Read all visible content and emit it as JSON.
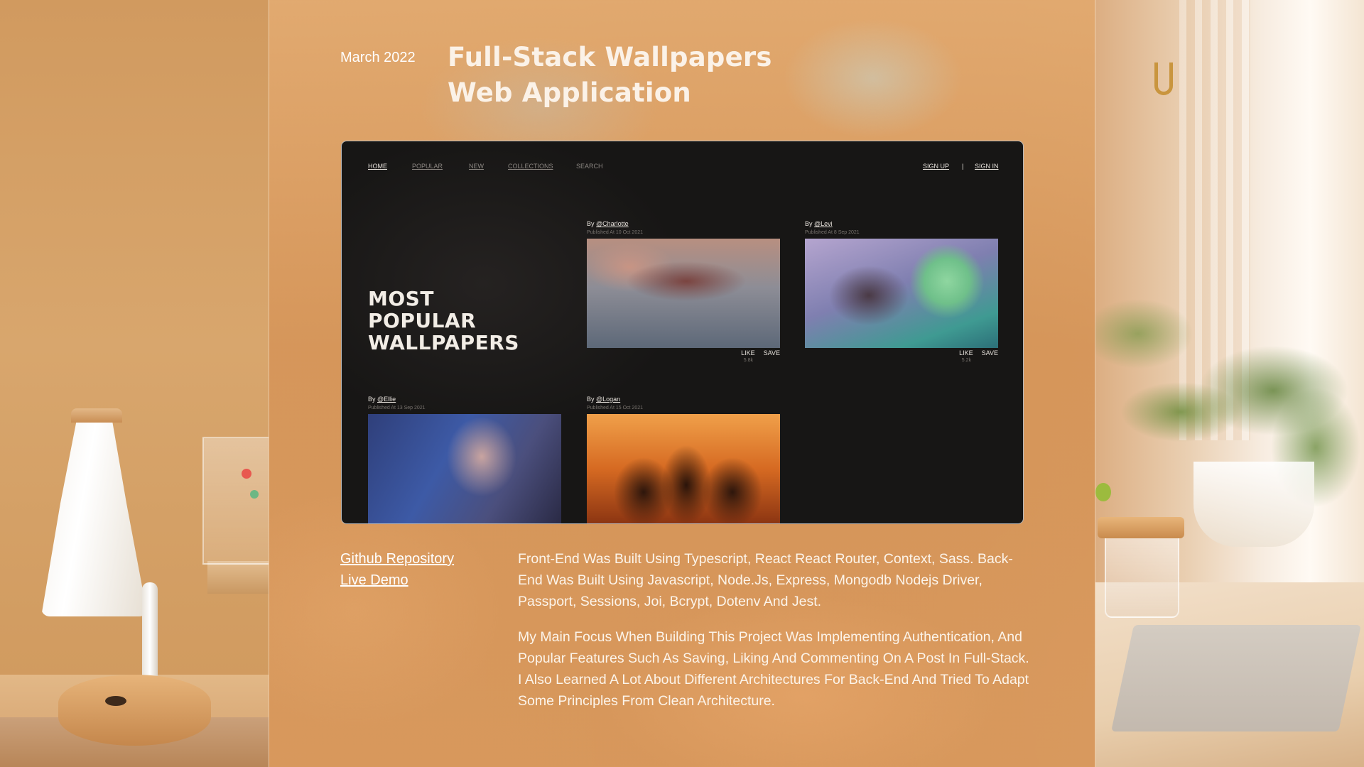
{
  "project": {
    "date": "March 2022",
    "title_line1": "Full-Stack Wallpapers",
    "title_line2": "Web Application"
  },
  "app": {
    "nav": [
      "HOME",
      "POPULAR",
      "NEW",
      "COLLECTIONS",
      "SEARCH"
    ],
    "auth": {
      "sign_up": "SIGN UP",
      "divider": "|",
      "sign_in": "SIGN IN"
    },
    "hero": [
      "MOST",
      "POPULAR",
      "WALLPAPERS"
    ],
    "cards": [
      {
        "by": "By ",
        "user": "@Charlotte",
        "published": "Published At 10 Oct 2021",
        "like": "LIKE",
        "save": "SAVE",
        "likes": "5.8k"
      },
      {
        "by": "By ",
        "user": "@Levi",
        "published": "Published At 8 Sep 2021",
        "like": "LIKE",
        "save": "SAVE",
        "likes": "5.2k"
      },
      {
        "by": "By ",
        "user": "@Ellie",
        "published": "Published At 13 Sep 2021"
      },
      {
        "by": "By ",
        "user": "@Logan",
        "published": "Published At 15 Oct 2021"
      }
    ]
  },
  "links": {
    "github": "Github Repository",
    "demo": "Live Demo"
  },
  "description": {
    "p1": "Front-End Was Built Using Typescript, React React Router, Context, Sass. Back-End Was Built Using Javascript, Node.Js, Express, Mongodb Nodejs Driver, Passport, Sessions, Joi, Bcrypt, Dotenv And Jest.",
    "p2": "My Main Focus When Building This Project Was Implementing Authentication, And Popular Features Such As Saving, Liking And Commenting On A Post In Full-Stack. I Also Learned A Lot About Different Architectures For Back-End And Tried To Adapt Some Principles From Clean Architecture."
  }
}
